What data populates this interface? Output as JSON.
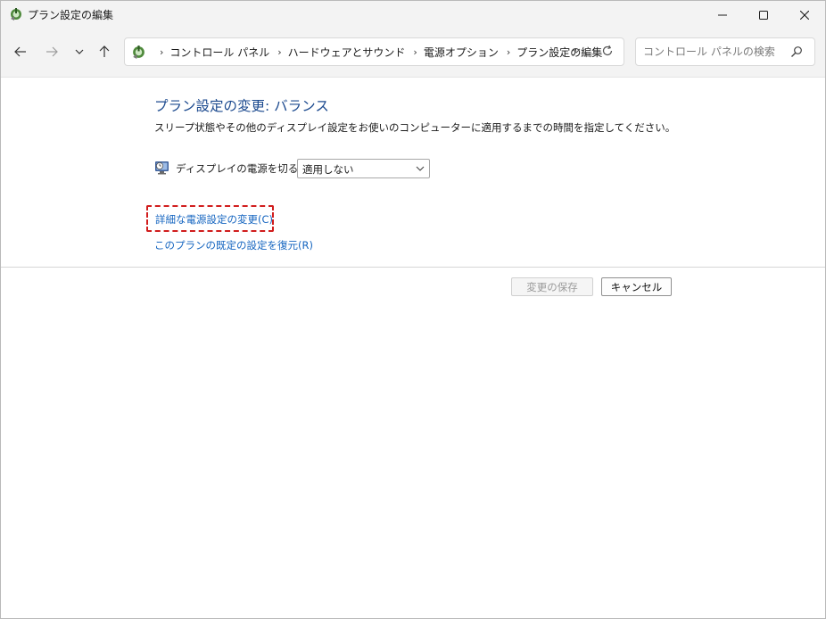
{
  "window": {
    "title": "プラン設定の編集"
  },
  "navigation": {
    "breadcrumbs": [
      "コントロール パネル",
      "ハードウェアとサウンド",
      "電源オプション",
      "プラン設定の編集"
    ],
    "search_placeholder": "コントロール パネルの検索"
  },
  "content": {
    "heading": "プラン設定の変更: バランス",
    "description": "スリープ状態やその他のディスプレイ設定をお使いのコンピューターに適用するまでの時間を指定してください。",
    "display_off_label": "ディスプレイの電源を切る:",
    "display_off_value": "適用しない",
    "advanced_link": "詳細な電源設定の変更(C)",
    "restore_link": "このプランの既定の設定を復元(R)"
  },
  "buttons": {
    "save": "変更の保存",
    "cancel": "キャンセル"
  },
  "colors": {
    "heading": "#1c4a8f",
    "link": "#1565c0",
    "highlight_frame": "#d11d1d"
  },
  "icons": {
    "title": "power-options-icon",
    "address": "power-options-icon",
    "display_setting": "monitor-clock-icon"
  }
}
